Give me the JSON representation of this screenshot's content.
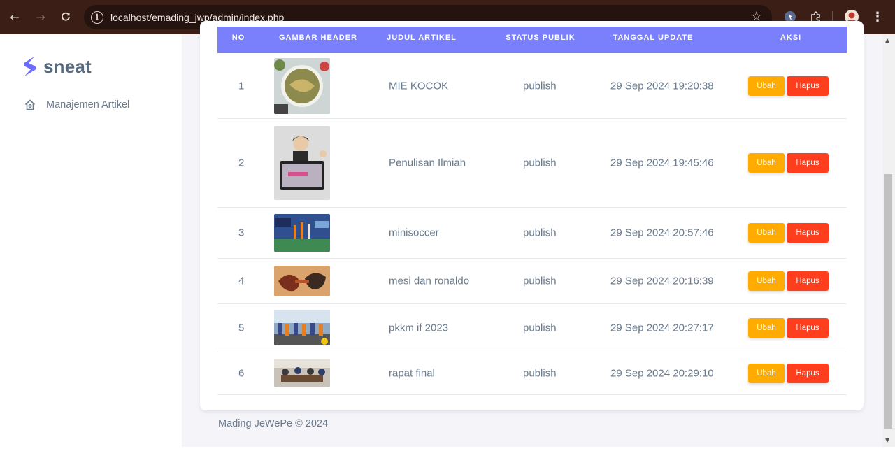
{
  "browser": {
    "url": "localhost/emading_jwp/admin/index.php",
    "back_icon": "arrow-left-icon",
    "forward_icon": "arrow-right-icon",
    "reload_icon": "reload-icon"
  },
  "sidebar": {
    "brand": "sneat",
    "items": [
      {
        "label": "Manajemen Artikel",
        "icon": "home-icon"
      }
    ]
  },
  "table": {
    "headers": [
      "NO",
      "GAMBAR HEADER",
      "JUDUL ARTIKEL",
      "STATUS PUBLIK",
      "TANGGAL UPDATE",
      "AKSI"
    ],
    "rows": [
      {
        "no": "1",
        "title": "MIE KOCOK",
        "status": "publish",
        "date": "29 Sep 2024 19:20:38",
        "edit": "Ubah",
        "delete": "Hapus"
      },
      {
        "no": "2",
        "title": "Penulisan Ilmiah",
        "status": "publish",
        "date": "29 Sep 2024 19:45:46",
        "edit": "Ubah",
        "delete": "Hapus"
      },
      {
        "no": "3",
        "title": "minisoccer",
        "status": "publish",
        "date": "29 Sep 2024 20:57:46",
        "edit": "Ubah",
        "delete": "Hapus"
      },
      {
        "no": "4",
        "title": "mesi dan ronaldo",
        "status": "publish",
        "date": "29 Sep 2024 20:16:39",
        "edit": "Ubah",
        "delete": "Hapus"
      },
      {
        "no": "5",
        "title": "pkkm if 2023",
        "status": "publish",
        "date": "29 Sep 2024 20:27:17",
        "edit": "Ubah",
        "delete": "Hapus"
      },
      {
        "no": "6",
        "title": "rapat final",
        "status": "publish",
        "date": "29 Sep 2024 20:29:10",
        "edit": "Ubah",
        "delete": "Hapus"
      }
    ]
  },
  "footer": {
    "text": "Mading JeWePe © 2024"
  },
  "colors": {
    "primary": "#7a7ffc",
    "edit_button": "#ffab00",
    "delete_button": "#ff3e1d",
    "browser_chrome": "#3b1f17"
  }
}
